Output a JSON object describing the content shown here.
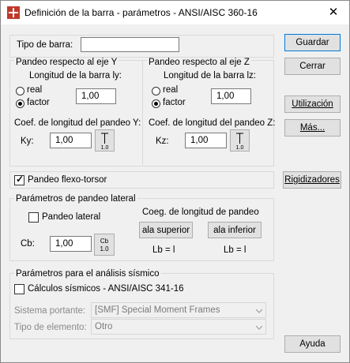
{
  "window": {
    "title": "Definición de la barra - parámetros - ANSI/AISC 360-16",
    "close": "✕"
  },
  "tipo": {
    "label": "Tipo de barra:",
    "value": ""
  },
  "groupY": {
    "title": "Pandeo respecto al eje Y",
    "longitud": "Longitud de la barra ly:",
    "real": "real",
    "factor": "factor",
    "value": "1,00",
    "coef": "Coef. de longitud del pandeo Y:",
    "k_label": "Ky:",
    "k_value": "1,00",
    "icon_text": "1.0"
  },
  "groupZ": {
    "title": "Pandeo respecto al eje Z",
    "longitud": "Longitud de la barra lz:",
    "real": "real",
    "factor": "factor",
    "value": "1,00",
    "coef": "Coef. de longitud del pandeo Z:",
    "k_label": "Kz:",
    "k_value": "1,00",
    "icon_text": "1.0"
  },
  "flexo": {
    "label": "Pandeo flexo-torsor",
    "checked": true
  },
  "lateral": {
    "title": "Parámetros de pandeo lateral",
    "pandeo_label": "Pandeo lateral",
    "cb_label": "Cb:",
    "cb_value": "1,00",
    "cb_icon_top": "Cb",
    "cb_icon_bottom": "1.0",
    "coeg": "Coeg. de longitud de pandeo",
    "sup": "ala superior",
    "inf": "ala inferior",
    "lb1": "Lb = l",
    "lb2": "Lb = l"
  },
  "sismico": {
    "title": "Parámetros para el análisis sísmico",
    "calc": "Cálculos sísmicos - ANSI/AISC 341-16",
    "sistema_label": "Sistema portante:",
    "sistema_value": "[SMF] Special Moment Frames",
    "tipo_label": "Tipo de elemento:",
    "tipo_value": "Otro"
  },
  "buttons": {
    "guardar": "Guardar",
    "cerrar": "Cerrar",
    "utilizacion": "Utilización",
    "mas": "Más...",
    "rigidizadores": "Rigidizadores",
    "ayuda": "Ayuda"
  },
  "colors": {
    "accent": "#0078d7",
    "title_icon": "#c0392b"
  }
}
